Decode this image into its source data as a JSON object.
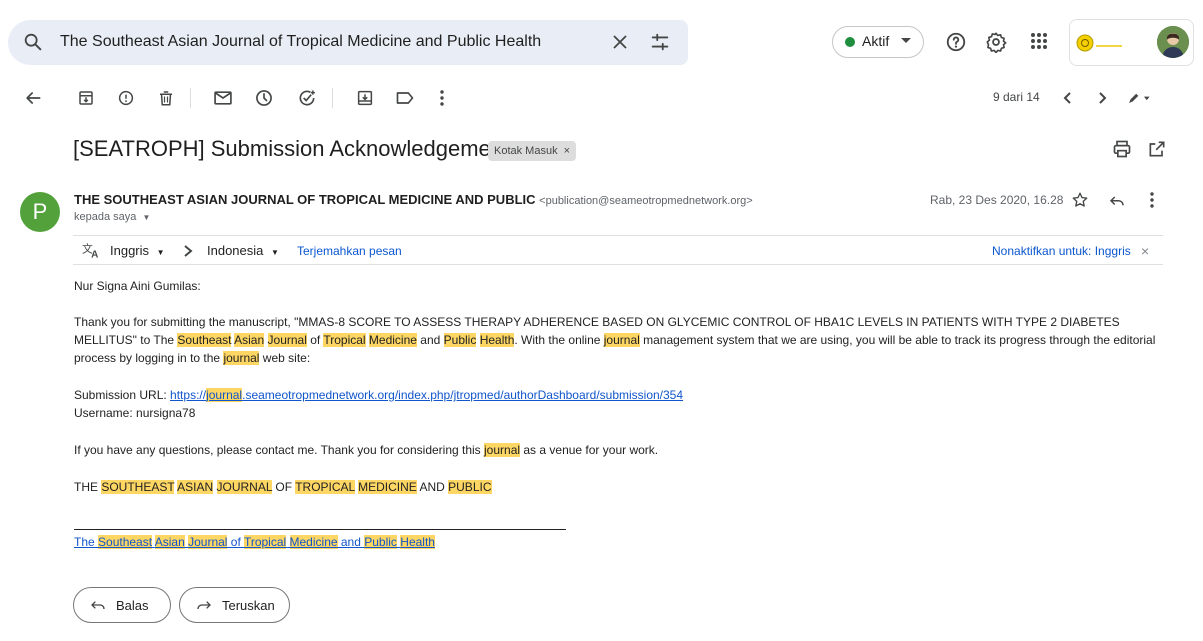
{
  "search": {
    "query": "The Southeast Asian Journal of Tropical Medicine and Public Health"
  },
  "status": {
    "label": "Aktif",
    "color": "#1e8e3e"
  },
  "toolbar": {
    "page_count": "9 dari 14"
  },
  "message": {
    "subject": "[SEATROPH] Submission Acknowledgement",
    "label_chip": "Kotak Masuk",
    "sender_initial": "P",
    "sender_name": "THE SOUTHEAST ASIAN JOURNAL OF TROPICAL MEDICINE AND PUBLIC",
    "sender_email": "<publication@seameotropmednetwork.org>",
    "recipient": "kepada saya",
    "date": "Rab, 23 Des 2020, 16.28"
  },
  "translate": {
    "from_lang": "Inggris",
    "to_lang": "Indonesia",
    "translate_link": "Terjemahkan pesan",
    "disable_link": "Nonaktifkan untuk: Inggris"
  },
  "body": {
    "greeting": "Nur Signa Aini Gumilas:",
    "para1_a": "Thank you for submitting the manuscript, \"MMAS-8 SCORE TO ASSESS THERAPY ADHERENCE BASED ON GLYCEMIC CONTROL OF HBA1C LEVELS IN PATIENTS WITH TYPE 2 DIABETES MELLITUS\" to The ",
    "para1_southeast": "Southeast",
    "para1_asian": "Asian",
    "para1_journal": "Journal",
    "para1_of": " of ",
    "para1_tropical": "Tropical",
    "para1_medicine": "Medicine",
    "para1_and": " and ",
    "para1_public": "Public",
    "para1_health": "Health",
    "para1_b": ". With the online ",
    "para1_journal2": "journal",
    "para1_c": " management system that we are using, you will be able to track its progress through the editorial process by logging in to the ",
    "para1_journal3": "journal",
    "para1_d": " web site:",
    "url_label": "Submission URL: ",
    "url_prefix": "https://",
    "url_journal": "journal",
    "url_rest": ".seameotropmednetwork.org/index.php/jtropmed/authorDashboard/submission/354",
    "username": "Username: nursigna78",
    "para2_a": "If you have any questions, please contact me. Thank you for considering this ",
    "para2_journal": "journal",
    "para2_b": " as a venue for your work.",
    "sig_the": "THE ",
    "sig_southeast": "SOUTHEAST",
    "sig_asian": "ASIAN",
    "sig_journal": "JOURNAL",
    "sig_of": " OF ",
    "sig_tropical": "TROPICAL",
    "sig_medicine": "MEDICINE",
    "sig_and": " AND ",
    "sig_public": "PUBLIC",
    "footer_the": "The ",
    "footer_southeast": "Southeast",
    "footer_asian": "Asian",
    "footer_journal": "Journal",
    "footer_of": " of ",
    "footer_tropical": "Tropical",
    "footer_medicine": "Medicine",
    "footer_and": " and ",
    "footer_public": "Public",
    "footer_health": "Health"
  },
  "actions": {
    "reply": "Balas",
    "forward": "Teruskan"
  },
  "icons": [
    "search-icon",
    "clear-icon",
    "filter-icon",
    "help-icon",
    "settings-icon",
    "apps-icon",
    "back-icon",
    "archive-icon",
    "report-spam-icon",
    "delete-icon",
    "mark-unread-icon",
    "snooze-icon",
    "add-task-icon",
    "move-to-icon",
    "label-icon",
    "more-icon",
    "prev-icon",
    "next-icon",
    "pen-icon",
    "print-icon",
    "open-new-window-icon",
    "star-icon",
    "reply-icon",
    "translate-icon"
  ]
}
